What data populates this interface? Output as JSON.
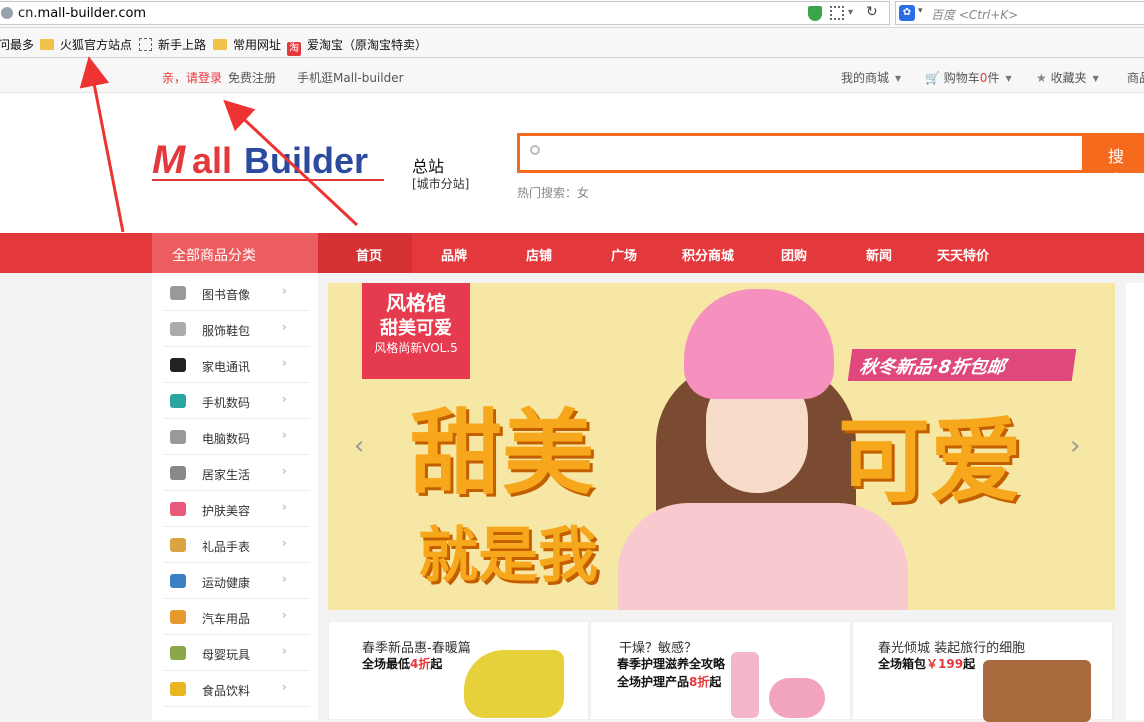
{
  "browser": {
    "url_prefix": "cn.",
    "url_host": "mall-builder.com",
    "search_placeholder": "百度 <Ctrl+K>",
    "bookmarks": [
      "问最多",
      "火狐官方站点",
      "新手上路",
      "常用网址",
      "爱淘宝（原淘宝特卖）"
    ],
    "taobao_glyph": "淘"
  },
  "topbar": {
    "login": "亲，请登录",
    "register": "免费注册",
    "mobile": "手机逛Mall-builder",
    "my_mall": "我的商城",
    "cart_label": "购物车",
    "cart_count": "0",
    "cart_unit": "件",
    "favorites": "收藏夹",
    "more": "商品"
  },
  "header": {
    "logo_text": "MallBuilder",
    "site_title": "总站",
    "city_switch": "[城市分站]",
    "search_button": "搜 索",
    "hot_label": "热门搜索：",
    "hot_term": "女"
  },
  "nav": {
    "all_categories": "全部商品分类",
    "items": [
      "首页",
      "品牌",
      "店铺",
      "广场",
      "积分商城",
      "团购",
      "新闻",
      "天天特价"
    ]
  },
  "categories": [
    {
      "label": "图书音像",
      "icon": "book-icon",
      "color": "#999999"
    },
    {
      "label": "服饰鞋包",
      "icon": "ring-icon",
      "color": "#aaaaaa"
    },
    {
      "label": "家电通讯",
      "icon": "ball-icon",
      "color": "#222222"
    },
    {
      "label": "手机数码",
      "icon": "heel-icon",
      "color": "#2aa5a0"
    },
    {
      "label": "电脑数码",
      "icon": "computer-icon",
      "color": "#999999"
    },
    {
      "label": "居家生活",
      "icon": "hairdryer-icon",
      "color": "#888888"
    },
    {
      "label": "护肤美容",
      "icon": "cosmetic-icon",
      "color": "#e8597a"
    },
    {
      "label": "礼品手表",
      "icon": "gift-icon",
      "color": "#d9a441"
    },
    {
      "label": "运动健康",
      "icon": "curtain-icon",
      "color": "#3b7fc4"
    },
    {
      "label": "汽车用品",
      "icon": "sofa-icon",
      "color": "#e69a2e"
    },
    {
      "label": "母婴玩具",
      "icon": "shoe-icon",
      "color": "#8aa84a"
    },
    {
      "label": "食品饮料",
      "icon": "car-icon",
      "color": "#e8b623"
    }
  ],
  "banner": {
    "badge_title": "风格馆",
    "badge_sub": "甜美可爱",
    "badge_vol": "风格尚新VOL.5",
    "promo": "秋冬新品·8折包邮",
    "big_left": "甜美",
    "big_right": "可爱",
    "big_bottom": "就是我"
  },
  "cards": [
    {
      "title": "春季新品惠-春暖篇",
      "line1_pre": "全场最低",
      "line1_red": "4折",
      "line1_post": "起"
    },
    {
      "title": "干燥？敏感？",
      "line1": "春季护理滋养全攻略",
      "line2_pre": "全场护理产品",
      "line2_red": "8折",
      "line2_post": "起"
    },
    {
      "title": "春光倾城 装起旅行的细胞",
      "line1_pre": "全场箱包",
      "line1_red": "￥199",
      "line1_post": "起"
    }
  ],
  "colors": {
    "brand_red": "#e4393c",
    "search_orange": "#f66a1d"
  }
}
